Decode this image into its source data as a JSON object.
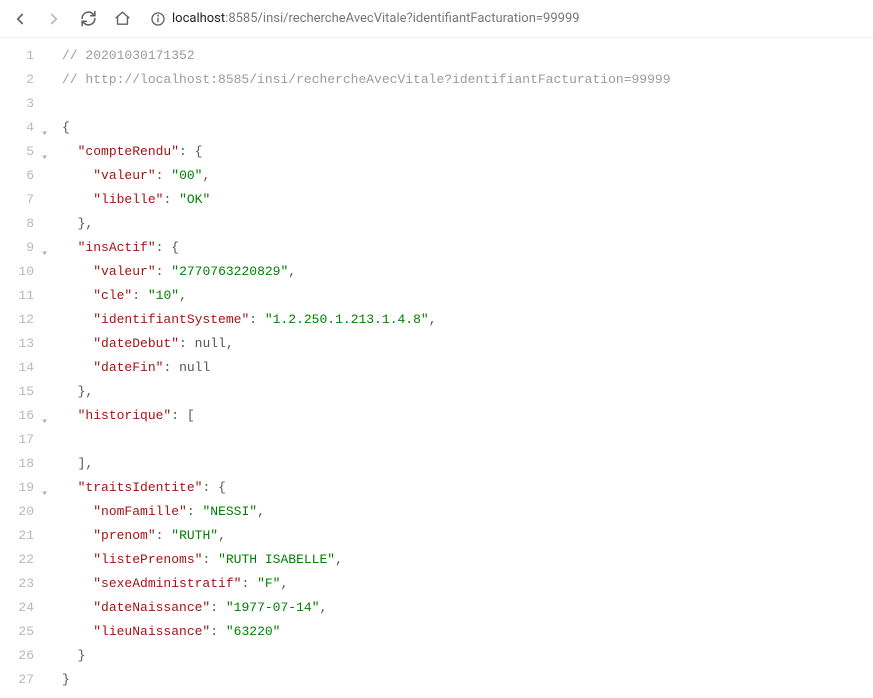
{
  "address": {
    "host": "localhost",
    "port": "8585",
    "rest": "/insi/rechercheAvecVitale?identifiantFacturation=99999"
  },
  "lines": [
    {
      "num": "1",
      "fold": false
    },
    {
      "num": "2",
      "fold": false
    },
    {
      "num": "3",
      "fold": false
    },
    {
      "num": "4",
      "fold": true
    },
    {
      "num": "5",
      "fold": true
    },
    {
      "num": "6",
      "fold": false
    },
    {
      "num": "7",
      "fold": false
    },
    {
      "num": "8",
      "fold": false
    },
    {
      "num": "9",
      "fold": true
    },
    {
      "num": "10",
      "fold": false
    },
    {
      "num": "11",
      "fold": false
    },
    {
      "num": "12",
      "fold": false
    },
    {
      "num": "13",
      "fold": false
    },
    {
      "num": "14",
      "fold": false
    },
    {
      "num": "15",
      "fold": false
    },
    {
      "num": "16",
      "fold": true
    },
    {
      "num": "17",
      "fold": false
    },
    {
      "num": "18",
      "fold": false
    },
    {
      "num": "19",
      "fold": true
    },
    {
      "num": "20",
      "fold": false
    },
    {
      "num": "21",
      "fold": false
    },
    {
      "num": "22",
      "fold": false
    },
    {
      "num": "23",
      "fold": false
    },
    {
      "num": "24",
      "fold": false
    },
    {
      "num": "25",
      "fold": false
    },
    {
      "num": "26",
      "fold": false
    },
    {
      "num": "27",
      "fold": false
    }
  ],
  "tokens": {
    "comment_ts": "// 20201030171352",
    "comment_url": "// http://localhost:8585/insi/rechercheAvecVitale?identifiantFacturation=99999",
    "brace_open": "{",
    "brace_close": "}",
    "bracket_open": "[",
    "bracket_close": "]",
    "colon": ":",
    "comma": ",",
    "null": "null",
    "q": "\"",
    "k_compteRendu": "compteRendu",
    "k_valeur": "valeur",
    "k_libelle": "libelle",
    "k_insActif": "insActif",
    "k_cle": "cle",
    "k_identifiantSysteme": "identifiantSysteme",
    "k_dateDebut": "dateDebut",
    "k_dateFin": "dateFin",
    "k_historique": "historique",
    "k_traitsIdentite": "traitsIdentite",
    "k_nomFamille": "nomFamille",
    "k_prenom": "prenom",
    "k_listePrenoms": "listePrenoms",
    "k_sexeAdministratif": "sexeAdministratif",
    "k_dateNaissance": "dateNaissance",
    "k_lieuNaissance": "lieuNaissance",
    "v_cr_valeur": "00",
    "v_cr_libelle": "OK",
    "v_ins_valeur": "2770763220829",
    "v_ins_cle": "10",
    "v_ins_idsys": "1.2.250.1.213.1.4.8",
    "v_ti_nomFamille": "NESSI",
    "v_ti_prenom": "RUTH",
    "v_ti_listePrenoms": "RUTH ISABELLE",
    "v_ti_sexe": "F",
    "v_ti_dateNaissance": "1977-07-14",
    "v_ti_lieuNaissance": "63220"
  }
}
